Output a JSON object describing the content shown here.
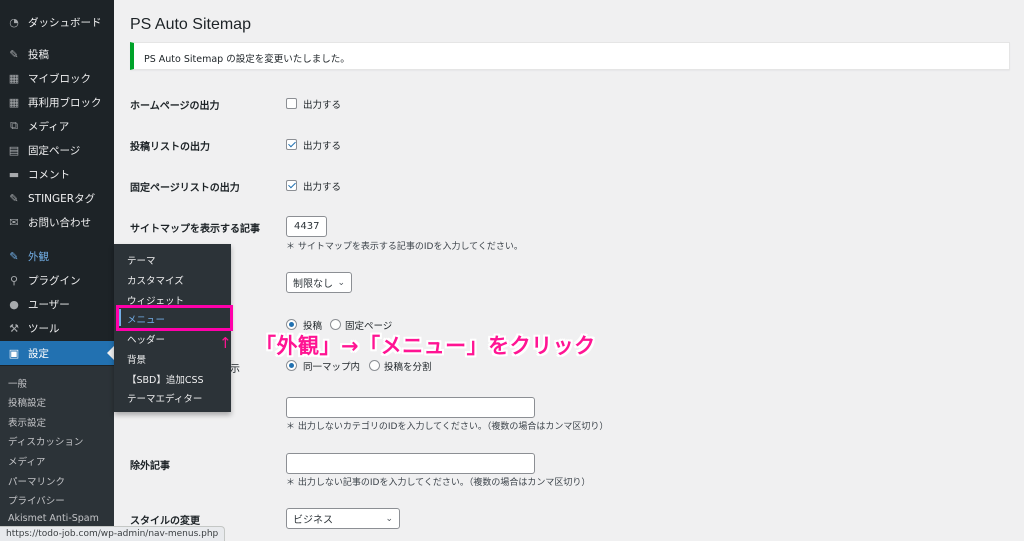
{
  "sidebar": {
    "items": [
      {
        "label": "ダッシュボード",
        "icon": "dashboard-icon"
      },
      {
        "label": "投稿",
        "icon": "pin-icon"
      },
      {
        "label": "マイブロック",
        "icon": "blocks-icon"
      },
      {
        "label": "再利用ブロック",
        "icon": "blocks-icon"
      },
      {
        "label": "メディア",
        "icon": "media-icon"
      },
      {
        "label": "固定ページ",
        "icon": "page-icon"
      },
      {
        "label": "コメント",
        "icon": "comment-icon"
      },
      {
        "label": "STINGERタグ",
        "icon": "pin-icon"
      },
      {
        "label": "お問い合わせ",
        "icon": "mail-icon"
      },
      {
        "label": "外観",
        "icon": "brush-icon"
      },
      {
        "label": "プラグイン",
        "icon": "plugin-icon"
      },
      {
        "label": "ユーザー",
        "icon": "user-icon"
      },
      {
        "label": "ツール",
        "icon": "wrench-icon"
      },
      {
        "label": "設定",
        "icon": "settings-icon"
      }
    ],
    "settings_submenu": [
      "一般",
      "投稿設定",
      "表示設定",
      "ディスカッション",
      "メディア",
      "パーマリンク",
      "プライバシー",
      "Akismet Anti-Spam"
    ]
  },
  "flyout": {
    "items": [
      "テーマ",
      "カスタマイズ",
      "ウィジェット",
      "メニュー",
      "ヘッダー",
      "背景",
      "【SBD】追加CSS",
      "テーマエディター"
    ]
  },
  "main": {
    "title": "PS Auto Sitemap",
    "notice": "PS Auto Sitemap の設定を変更いたしました。",
    "rows": {
      "home_label": "ホームページの出力",
      "home_option": "出力する",
      "posts_label": "投稿リストの出力",
      "posts_option": "出力する",
      "pages_label": "固定ページリストの出力",
      "pages_option": "出力する",
      "sitemap_label": "サイトマップを表示する記事",
      "sitemap_value": "4437",
      "sitemap_hint": "＊ サイトマップを表示する記事のIDを入力してください。",
      "depth_value": "制限なし",
      "first_radio_1": "投稿",
      "first_radio_2": "固定ページ",
      "category_label_tail": "示",
      "category_radio_1": "同一マップ内",
      "category_radio_2": "投稿を分割",
      "exclude_cat_hint": "＊ 出力しないカテゴリのIDを入力してください。（複数の場合はカンマ区切り）",
      "exclude_post_label": "除外記事",
      "exclude_post_hint": "＊ 出力しない記事のIDを入力してください。（複数の場合はカンマ区切り）",
      "style_label": "スタイルの変更",
      "style_value": "ビジネス"
    }
  },
  "annotation": {
    "text": "「外観」→「メニュー」をクリック",
    "arrow": "↑",
    "color": "#ff1493"
  },
  "statusbar": {
    "url": "https://todo-job.com/wp-admin/nav-menus.php"
  },
  "colors": {
    "sidebar_bg": "#1d2327",
    "active_bg": "#2271b1",
    "notice_border": "#00a32a",
    "highlight_box": "#ff00aa"
  }
}
